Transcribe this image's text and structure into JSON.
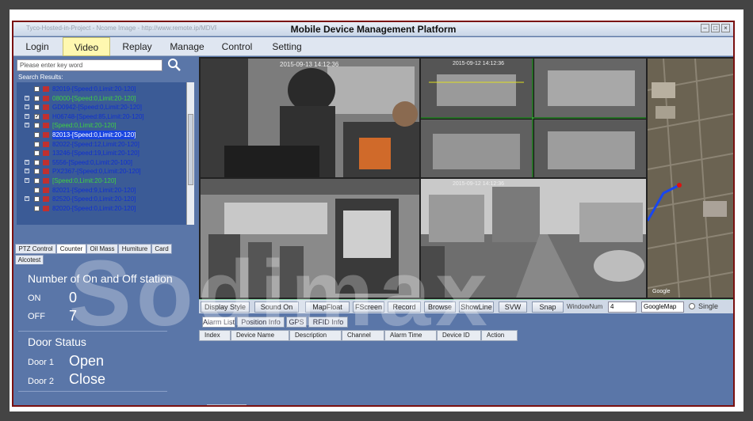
{
  "window": {
    "title": "Mobile Device Management Platform",
    "subtitle": "Tyco-Hosted-in-Project - Ncome Image - http://www.remote.ip/MDVR/login"
  },
  "menu": [
    "Login",
    "Video",
    "Replay",
    "Manage",
    "Control",
    "Setting"
  ],
  "menu_active": "Video",
  "search": {
    "placeholder": "Please enter key word",
    "results_label": "Search Results:"
  },
  "tree": [
    {
      "label": "82019-[Speed:0,Limit:20-120]",
      "color": "#1030d0",
      "exp": false,
      "icon": "vehicle-icon"
    },
    {
      "label": "08000-[Speed:0,Limit:20-120]",
      "color": "#40d040",
      "exp": true,
      "icon": "vehicle-icon"
    },
    {
      "label": "GD0942-[Speed:0,Limit:20-120]",
      "color": "#1030d0",
      "exp": true,
      "icon": "vehicle-icon"
    },
    {
      "label": "H06748-[Speed:85,Limit:20-120]",
      "color": "#1030d0",
      "exp": true,
      "icon": "vehicle-icon",
      "checked": true
    },
    {
      "label": "[Speed:0,Limit:20-120]",
      "color": "#40d040",
      "exp": true,
      "icon": "vehicle-icon"
    },
    {
      "label": "82013-[Speed:0,Limit:20-120]",
      "color": "#1030d0",
      "exp": false,
      "icon": "vehicle-icon",
      "selected": true
    },
    {
      "label": "82022-[Speed:12,Limit:20-120]",
      "color": "#1030d0",
      "exp": false,
      "icon": "vehicle-icon"
    },
    {
      "label": "13246-[Speed:19,Limit:20-120]",
      "color": "#1030d0",
      "exp": false,
      "icon": "vehicle-icon"
    },
    {
      "label": "5556-[Speed:0,Limit:20-100]",
      "color": "#1030d0",
      "exp": true,
      "icon": "vehicle-icon"
    },
    {
      "label": "PX2367-[Speed:0,Limit:20-120]",
      "color": "#1030d0",
      "exp": true,
      "icon": "vehicle-icon"
    },
    {
      "label": "[Speed:0,Limit:20-120]",
      "color": "#40d040",
      "exp": true,
      "icon": "vehicle-icon"
    },
    {
      "label": "82021-[Speed:9,Limit:20-120]",
      "color": "#1030d0",
      "exp": false,
      "icon": "vehicle-icon"
    },
    {
      "label": "82520-[Speed:0,Limit:20-120]",
      "color": "#1030d0",
      "exp": true,
      "icon": "vehicle-icon"
    },
    {
      "label": "82020-[Speed:0,Limit:20-120]",
      "color": "#1030d0",
      "exp": false,
      "icon": "vehicle-icon"
    }
  ],
  "left_tabs": [
    "PTZ Control",
    "Counter",
    "Oil Mass",
    "Humiture",
    "Card",
    "Alcotest"
  ],
  "left_tab_active": "Counter",
  "counter": {
    "title": "Number of On and Off station",
    "on_label": "ON",
    "on_value": "0",
    "off_label": "OFF",
    "off_value": "7",
    "door_title": "Door Status",
    "door1_label": "Door 1",
    "door1_value": "Open",
    "door2_label": "Door 2",
    "door2_value": "Close"
  },
  "video_controls": [
    "Display Style",
    "Sound On",
    "MapFloat",
    "FScreen",
    "Record",
    "Browse",
    "ShowLine",
    "SVW",
    "Snap"
  ],
  "window_num_label": "WindowNum",
  "window_num_value": "4",
  "map_select": "GoogleMap",
  "single_label": "Single",
  "alarm_tabs": [
    "Alarm List",
    "Position Info",
    "GPS",
    "RFID Info"
  ],
  "alarm_tab_active": "Alarm List",
  "alarm_columns": [
    "Index",
    "Device Name",
    "Description",
    "Channel",
    "Alarm Time",
    "Device ID",
    "Action"
  ],
  "cam_timestamps": [
    "2015-09-13 14:12:36",
    "2015-09-12 14:12:36",
    "2015-09-12 14:12:36"
  ],
  "map_label": "Google",
  "watermark": "Sodimax",
  "colors": {
    "frame": "#7a1010",
    "panel": "#5a76a8",
    "tree_bg": "#3b5b96"
  }
}
